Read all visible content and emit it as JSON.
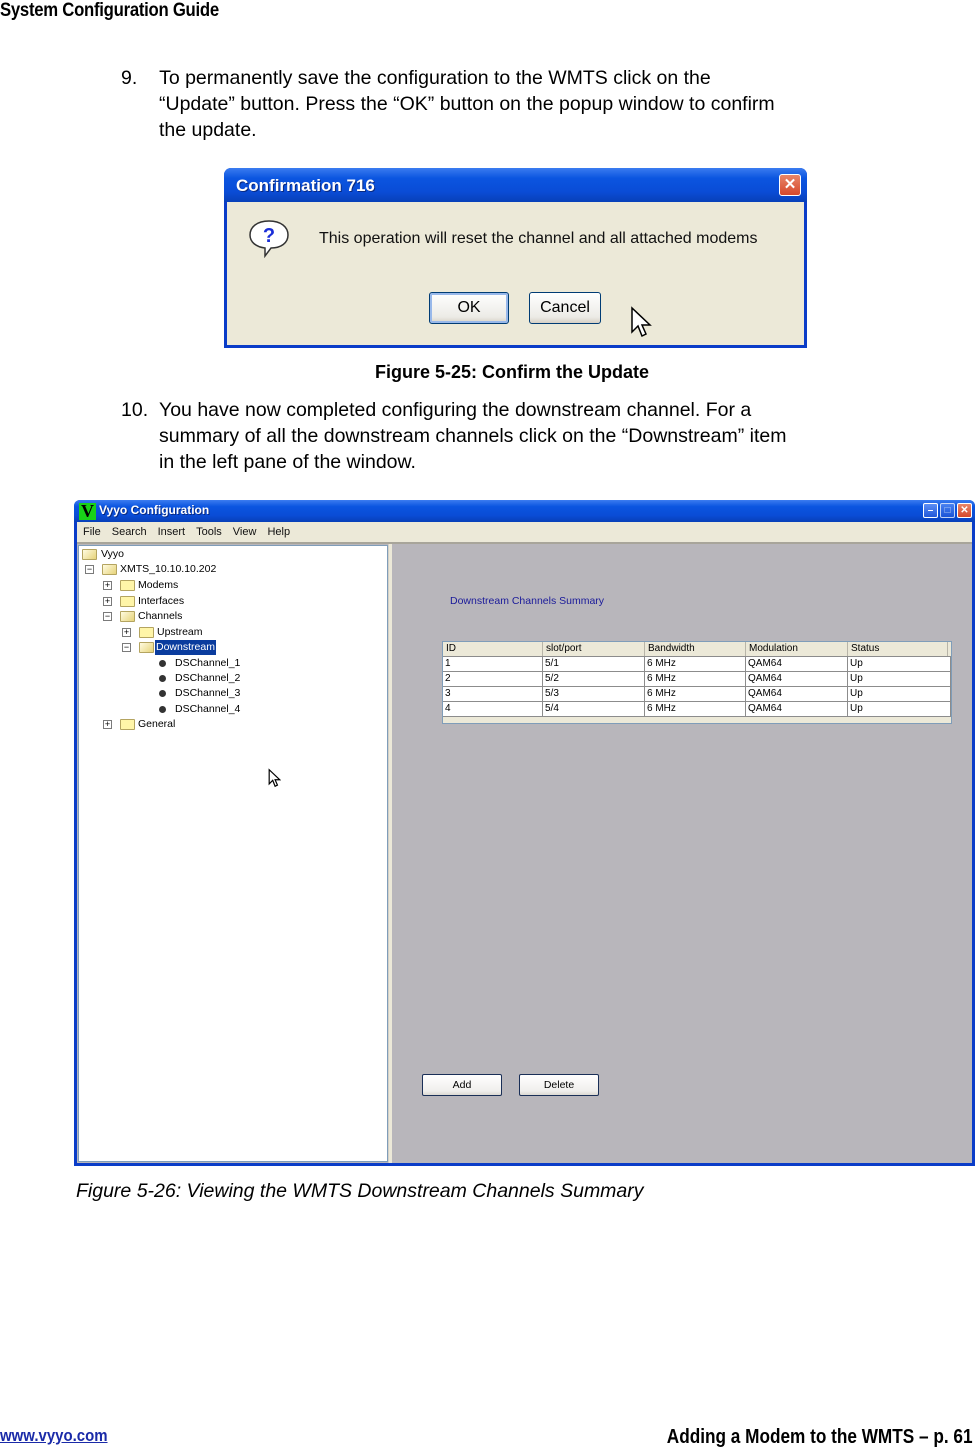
{
  "document": {
    "header": "System Configuration Guide",
    "steps": [
      {
        "number": "9.",
        "lines": [
          " To permanently save the configuration to the WMTS click on the",
          "“Update” button.  Press the “OK” button on the popup window to confirm",
          "the update."
        ]
      },
      {
        "number": "10.",
        "lines": [
          "You have now completed configuring the downstream channel.  For a",
          "summary of all the downstream channels click on the “Downstream” item",
          "in the left pane of the window."
        ]
      }
    ],
    "figure_25_caption": "Figure 5-25: Confirm the Update",
    "figure_26_caption": "Figure 5-26:  Viewing the WMTS Downstream Channels Summary",
    "footer": {
      "link": "www.vyyo.com",
      "page_label": "Adding a Modem to the WMTS – p. 61"
    }
  },
  "confirm_dialog": {
    "title": "Confirmation 716",
    "close_glyph": "✕",
    "icon": "question-icon",
    "message": "This operation will reset the channel and all attached modems",
    "ok_label": "OK",
    "cancel_label": "Cancel"
  },
  "config_window": {
    "title": "Vyyo Configuration",
    "logo_letter": "V",
    "controls": {
      "minimize": "–",
      "maximize": "□",
      "close": "✕"
    },
    "menu": [
      "File",
      "Search",
      "Insert",
      "Tools",
      "View",
      "Help"
    ],
    "tree": [
      {
        "label": "Vyyo",
        "type": "folder-open",
        "expander": "",
        "level": 0
      },
      {
        "label": "XMTS_10.10.10.202",
        "type": "folder-open",
        "expander": "−",
        "level": 1
      },
      {
        "label": "Modems",
        "type": "folder",
        "expander": "+",
        "level": 2
      },
      {
        "label": "Interfaces",
        "type": "folder",
        "expander": "+",
        "level": 2
      },
      {
        "label": "Channels",
        "type": "folder-open",
        "expander": "−",
        "level": 2
      },
      {
        "label": "Upstream",
        "type": "folder",
        "expander": "+",
        "level": 3
      },
      {
        "label": "Downstream",
        "type": "folder-open",
        "expander": "−",
        "level": 3,
        "selected": true
      },
      {
        "label": "DSChannel_1",
        "type": "leaf",
        "expander": "",
        "level": 4
      },
      {
        "label": "DSChannel_2",
        "type": "leaf",
        "expander": "",
        "level": 4
      },
      {
        "label": "DSChannel_3",
        "type": "leaf",
        "expander": "",
        "level": 4
      },
      {
        "label": "DSChannel_4",
        "type": "leaf",
        "expander": "",
        "level": 4
      },
      {
        "label": "General",
        "type": "folder",
        "expander": "+",
        "level": 2
      }
    ],
    "summary": {
      "title": "Downstream Channels Summary",
      "columns": [
        "ID",
        "slot/port",
        "Bandwidth",
        "Modulation",
        "Status"
      ],
      "rows": [
        [
          "1",
          "5/1",
          "6 MHz",
          "QAM64",
          "Up"
        ],
        [
          "2",
          "5/2",
          "6 MHz",
          "QAM64",
          "Up"
        ],
        [
          "3",
          "5/3",
          "6 MHz",
          "QAM64",
          "Up"
        ],
        [
          "4",
          "5/4",
          "6 MHz",
          "QAM64",
          "Up"
        ]
      ],
      "add_label": "Add",
      "delete_label": "Delete"
    }
  }
}
